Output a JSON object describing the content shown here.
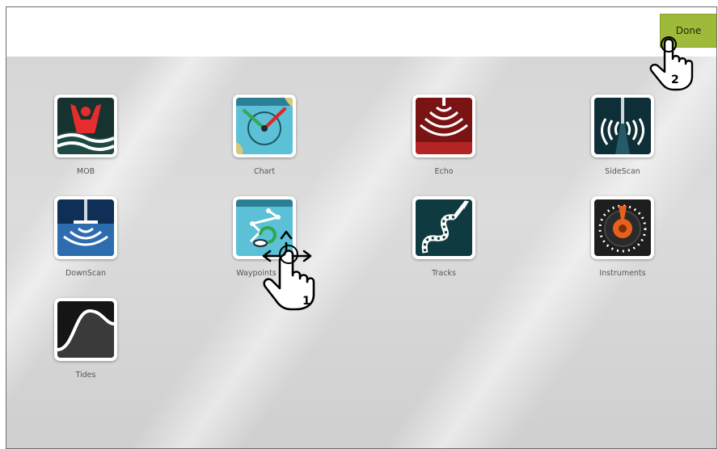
{
  "toolbar": {
    "done_label": "Done"
  },
  "apps": [
    {
      "label": "MOB",
      "icon": "mob-icon"
    },
    {
      "label": "Chart",
      "icon": "chart-icon"
    },
    {
      "label": "Echo",
      "icon": "echo-icon"
    },
    {
      "label": "SideScan",
      "icon": "sidescan-icon"
    },
    {
      "label": "DownScan",
      "icon": "downscan-icon"
    },
    {
      "label": "Waypoints & R",
      "icon": "waypoints-icon"
    },
    {
      "label": "Tracks",
      "icon": "tracks-icon"
    },
    {
      "label": "Instruments",
      "icon": "instruments-icon"
    },
    {
      "label": "Tides",
      "icon": "tides-icon"
    }
  ],
  "callouts": {
    "drag_step": "1",
    "done_step": "2"
  },
  "colors": {
    "done_button": "#9fb93a",
    "accent_green": "#7fb531"
  }
}
